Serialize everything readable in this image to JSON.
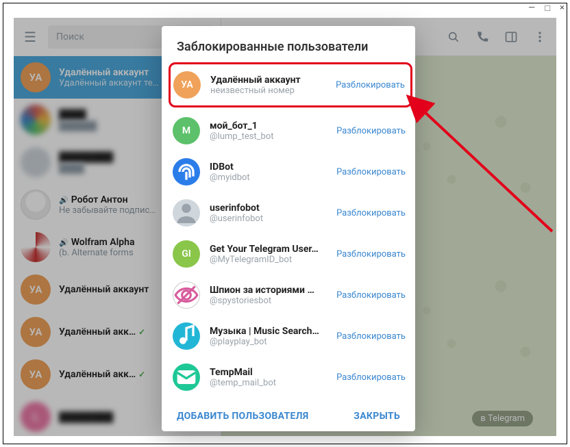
{
  "window": {
    "minimize": "—",
    "maximize": "□",
    "close": "×"
  },
  "search": {
    "placeholder": "Поиск"
  },
  "chats": [
    {
      "avatarText": "УА",
      "avatarClass": "av-orange",
      "title": "Удалённый аккаунт",
      "sub": "Удалённый аккаунт те…",
      "active": true
    },
    {
      "avatarText": "",
      "avatarClass": "av-mosaic1",
      "title": "████",
      "sub": "██████",
      "blur": true
    },
    {
      "avatarText": "",
      "avatarClass": "av-grey",
      "title": "████████",
      "sub": "████",
      "blur": true
    },
    {
      "avatarText": "",
      "avatarClass": "av-robot",
      "title": "Робот Антон",
      "sub": "Не забывайте подпис…",
      "badge": "🔊"
    },
    {
      "avatarText": "",
      "avatarClass": "av-mosaic2",
      "title": "Wolfram Alpha",
      "sub": "(b. Alternate forms",
      "badge": "🔊"
    },
    {
      "avatarText": "УА",
      "avatarClass": "av-orange",
      "title": "Удалённый аккаунт",
      "sub": ""
    },
    {
      "avatarText": "УА",
      "avatarClass": "av-orange",
      "title": "Удалённый акк…",
      "sub": "",
      "tick": true
    },
    {
      "avatarText": "УА",
      "avatarClass": "av-orange",
      "title": "Удалённый акк…",
      "sub": "",
      "tick": true
    },
    {
      "avatarText": "L",
      "avatarClass": "av-pink",
      "title": "████████",
      "sub": "",
      "blur": true
    }
  ],
  "chip": "в Telegram",
  "modal": {
    "title": "Заблокированные пользователи",
    "unblock_label": "Разблокировать",
    "add_user": "ДОБАВИТЬ ПОЛЬЗОВАТЕЛЯ",
    "close": "ЗАКРЫТЬ",
    "rows": [
      {
        "avatarText": "УА",
        "avatarClass": "av-orange",
        "name": "Удалённый аккаунт",
        "sub": "неизвестный номер",
        "highlight": true
      },
      {
        "avatarText": "М",
        "avatarClass": "av-green",
        "name": "мой_бот_1",
        "sub": "@lump_test_bot"
      },
      {
        "avatarText": "",
        "avatarClass": "av-blue",
        "name": "IDBot",
        "sub": "@myidbot",
        "iconSvg": "fingerprint"
      },
      {
        "avatarText": "",
        "avatarClass": "av-grey",
        "name": "userinfobot",
        "sub": "@userinfobot",
        "iconSvg": "person"
      },
      {
        "avatarText": "GI",
        "avatarClass": "av-lime",
        "name": "Get Your Telegram User…",
        "sub": "@MyTelegramID_bot"
      },
      {
        "avatarText": "",
        "avatarClass": "av-white",
        "name": "Шпион за историями …",
        "sub": "@spystoriesbot",
        "iconSvg": "eye-off"
      },
      {
        "avatarText": "",
        "avatarClass": "av-cyan",
        "name": "Музыка | Music Search…",
        "sub": "@playplay_bot",
        "iconSvg": "music"
      },
      {
        "avatarText": "",
        "avatarClass": "av-teal",
        "name": "TempMail",
        "sub": "@temp_mail_bot",
        "iconSvg": "mail"
      }
    ]
  }
}
